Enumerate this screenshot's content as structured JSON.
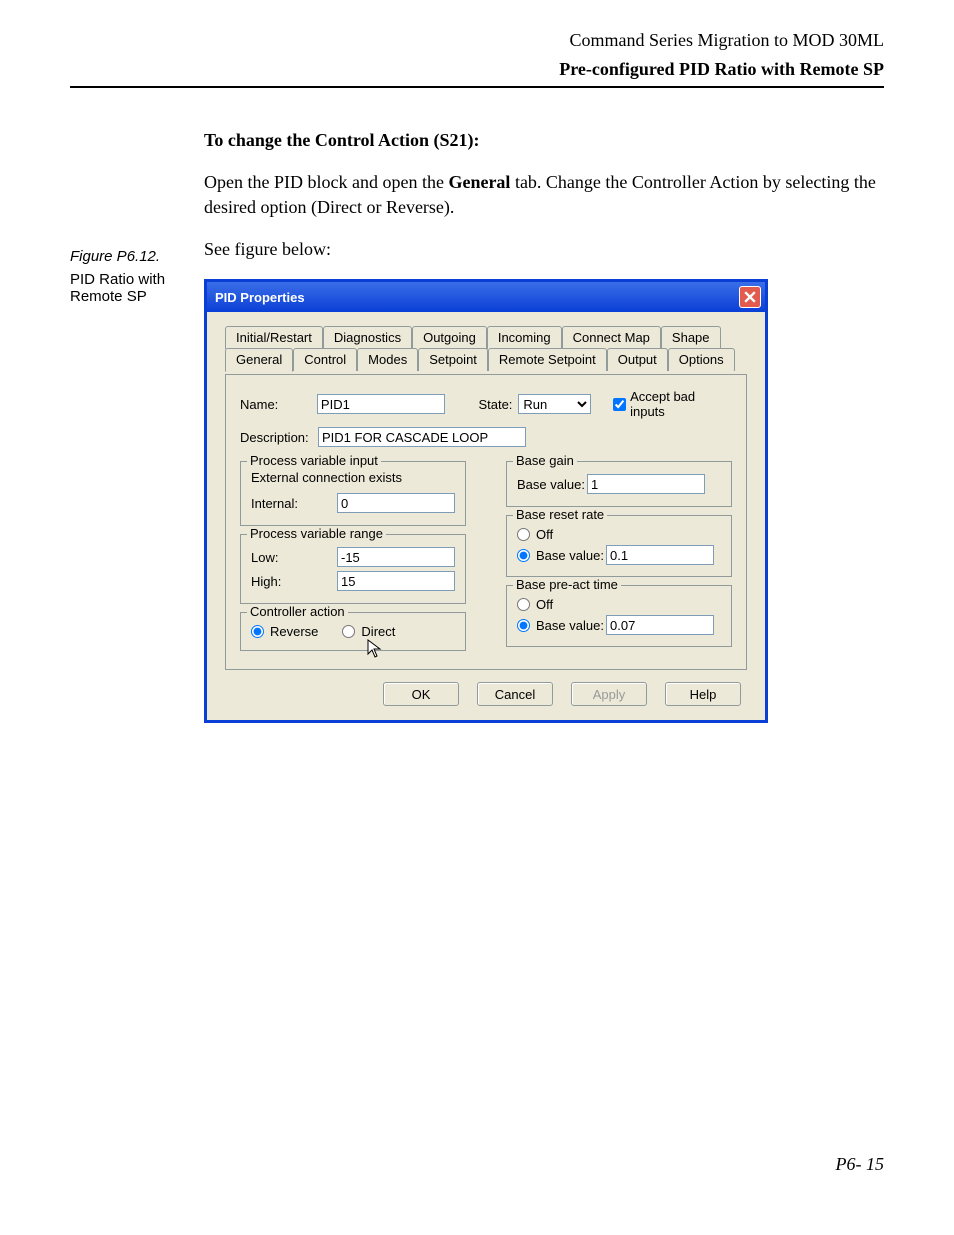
{
  "header": {
    "line1": "Command Series Migration to MOD 30ML",
    "line2": "Pre-configured PID Ratio with Remote SP"
  },
  "sidebar": {
    "figure_label": "Figure P6.12.",
    "figure_caption": "PID Ratio with Remote SP"
  },
  "body": {
    "h1": "To change the Control Action (S21):",
    "p1a": "Open the PID block and open the ",
    "p1_bold": "General",
    "p1b": " tab. Change the Controller Action by selecting the desired option (Direct or Reverse).",
    "p2": "See figure below:"
  },
  "dialog": {
    "title": "PID Properties",
    "tabs_top": [
      "Initial/Restart",
      "Diagnostics",
      "Outgoing",
      "Incoming",
      "Connect Map",
      "Shape"
    ],
    "tabs_bottom": [
      "General",
      "Control",
      "Modes",
      "Setpoint",
      "Remote Setpoint",
      "Output",
      "Options"
    ],
    "active_tab": "General",
    "name_label": "Name:",
    "name_value": "PID1",
    "state_label": "State:",
    "state_value": "Run",
    "accept_bad_label": "Accept bad inputs",
    "accept_bad_checked": true,
    "desc_label": "Description:",
    "desc_value": "PID1 FOR CASCADE LOOP",
    "groups": {
      "pv_input": {
        "legend": "Process variable input",
        "ext_text": "External connection exists",
        "internal_label": "Internal:",
        "internal_value": "0"
      },
      "pv_range": {
        "legend": "Process variable range",
        "low_label": "Low:",
        "low_value": "-15",
        "high_label": "High:",
        "high_value": "15"
      },
      "controller_action": {
        "legend": "Controller action",
        "reverse_label": "Reverse",
        "direct_label": "Direct",
        "selected": "Reverse"
      },
      "base_gain": {
        "legend": "Base gain",
        "base_value_label": "Base value:",
        "base_value": "1"
      },
      "base_reset": {
        "legend": "Base reset rate",
        "off_label": "Off",
        "base_value_label": "Base value:",
        "base_value": "0.1",
        "selected": "Base value"
      },
      "base_preact": {
        "legend": "Base pre-act time",
        "off_label": "Off",
        "base_value_label": "Base value:",
        "base_value": "0.07",
        "selected": "Base value"
      }
    },
    "buttons": {
      "ok": "OK",
      "cancel": "Cancel",
      "apply": "Apply",
      "help": "Help"
    }
  },
  "footer": "P6- 15"
}
